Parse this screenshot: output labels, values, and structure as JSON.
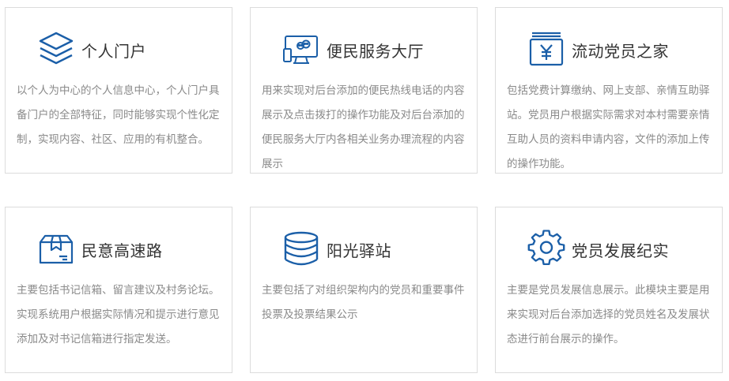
{
  "accent_color": "#1b5fa8",
  "cards": [
    {
      "icon": "layers-icon",
      "title": "个人门户",
      "description": "以个人为中心的个人信息中心，个人门户具备门户的全部特征，同时能够实现个性化定制，实现内容、社区、应用的有机整合。"
    },
    {
      "icon": "devices-chat-icon",
      "title": "便民服务大厅",
      "description": "用来实现对后台添加的便民热线电话的内容展示及点击拨打的操作功能及对后台添加的便民服务大厅内各相关业务办理流程的内容展示"
    },
    {
      "icon": "yen-box-icon",
      "title": "流动党员之家",
      "description": "包括党费计算缴纳、网上支部、亲情互助驿站。党员用户根据实际需求对本村需要亲情互助人员的资料申请内容，文件的添加上传的操作功能。"
    },
    {
      "icon": "package-box-icon",
      "title": "民意高速路",
      "description": "主要包括书记信箱、留言建议及村务论坛。实现系统用户根据实际情况和提示进行意见添加及对书记信箱进行指定发送。"
    },
    {
      "icon": "database-icon",
      "title": "阳光驿站",
      "description": "主要包括了对组织架构内的党员和重要事件投票及投票结果公示"
    },
    {
      "icon": "gear-icon",
      "title": "党员发展纪实",
      "description": "主要是党员发展信息展示。此模块主要是用来实现对后台添加选择的党员姓名及发展状态进行前台展示的操作。"
    }
  ]
}
